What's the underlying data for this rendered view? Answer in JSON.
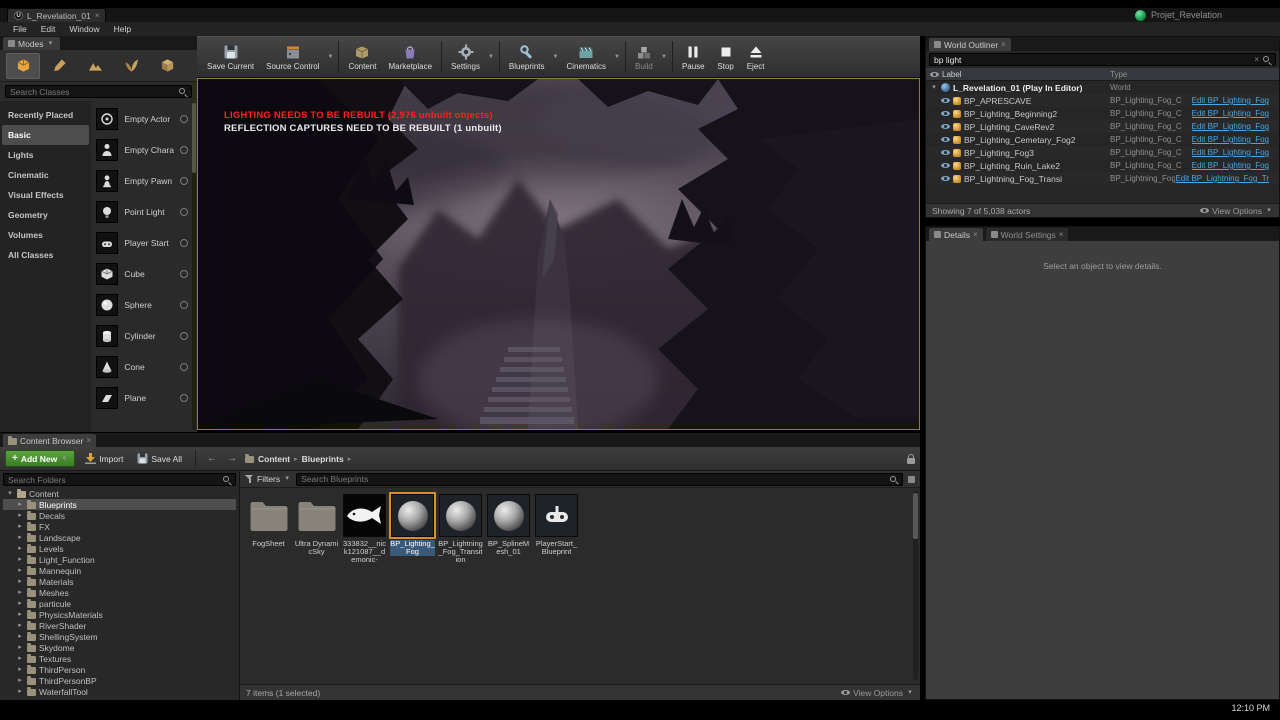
{
  "titlebar": {
    "tab_title": "L_Revelation_01",
    "project_name": "Projet_Revelation"
  },
  "menu": [
    "File",
    "Edit",
    "Window",
    "Help"
  ],
  "modes": {
    "tab": "Modes",
    "search_placeholder": "Search Classes",
    "categories": [
      "Recently Placed",
      "Basic",
      "Lights",
      "Cinematic",
      "Visual Effects",
      "Geometry",
      "Volumes",
      "All Classes"
    ],
    "selected_category": "Basic",
    "items": [
      "Empty Actor",
      "Empty Chara",
      "Empty Pawn",
      "Point Light",
      "Player Start",
      "Cube",
      "Sphere",
      "Cylinder",
      "Cone",
      "Plane"
    ]
  },
  "toolbar": [
    "Save Current",
    "Source Control",
    "Content",
    "Marketplace",
    "Settings",
    "Blueprints",
    "Cinematics",
    "Build",
    "Pause",
    "Stop",
    "Eject"
  ],
  "viewport": {
    "warning_lighting": "LIGHTING NEEDS TO BE REBUILT (2,976 unbuilt objects)",
    "warning_reflection": "REFLECTION CAPTURES NEED TO BE REBUILT (1 unbuilt)"
  },
  "outliner": {
    "tab": "World Outliner",
    "search_value": "bp light",
    "col_label": "Label",
    "col_type": "Type",
    "root": {
      "label": "L_Revelation_01 (Play In Editor)",
      "type": "World"
    },
    "rows": [
      {
        "label": "BP_APRESCAVE",
        "type": "BP_Lighting_Fog_C",
        "link": "Edit BP_Lighting_Fog"
      },
      {
        "label": "BP_Lighting_Beginning2",
        "type": "BP_Lighting_Fog_C",
        "link": "Edit BP_Lighting_Fog"
      },
      {
        "label": "BP_Lighting_CaveRev2",
        "type": "BP_Lighting_Fog_C",
        "link": "Edit BP_Lighting_Fog"
      },
      {
        "label": "BP_Lighting_Cemetary_Fog2",
        "type": "BP_Lighting_Fog_C",
        "link": "Edit BP_Lighting_Fog"
      },
      {
        "label": "BP_Lighting_Fog3",
        "type": "BP_Lighting_Fog_C",
        "link": "Edit BP_Lighting_Fog"
      },
      {
        "label": "BP_Lighting_Ruin_Lake2",
        "type": "BP_Lighting_Fog_C",
        "link": "Edit BP_Lighting_Fog"
      },
      {
        "label": "BP_Lightning_Fog_Transi",
        "type": "BP_Lightning_Fog_Transition_C",
        "link": "Edit BP_Lightning_Fog_Tr"
      }
    ],
    "status": "Showing 7 of 5,038 actors",
    "view_options": "View Options"
  },
  "details": {
    "tab_details": "Details",
    "tab_world_settings": "World Settings",
    "empty_message": "Select an object to view details."
  },
  "content_browser": {
    "tab": "Content Browser",
    "add_new": "Add New",
    "import": "Import",
    "save_all": "Save All",
    "breadcrumb": [
      "Content",
      "Blueprints"
    ],
    "filters": "Filters",
    "search_placeholder": "Search Blueprints",
    "folder_search_placeholder": "Search Folders",
    "tree_root": "Content",
    "tree": [
      "Blueprints",
      "Decals",
      "FX",
      "Landscape",
      "Levels",
      "Light_Function",
      "Mannequin",
      "Materials",
      "Meshes",
      "particule",
      "PhysicsMaterials",
      "RiverShader",
      "ShellingSystem",
      "Skydome",
      "Textures",
      "ThirdPerson",
      "ThirdPersonBP",
      "WaterfallTool"
    ],
    "assets": [
      {
        "name": "FogSheet",
        "kind": "folder"
      },
      {
        "name": "Ultra DynamicSky",
        "kind": "folder"
      },
      {
        "name": "333832__nick121087__demonic-",
        "kind": "texture"
      },
      {
        "name": "BP_Lighting_Fog",
        "kind": "blueprint",
        "selected": true
      },
      {
        "name": "BP_Lightning_Fog_Transition",
        "kind": "blueprint"
      },
      {
        "name": "BP_SplineMesh_01",
        "kind": "blueprint"
      },
      {
        "name": "PlayerStart_Blueprint",
        "kind": "blueprint"
      }
    ],
    "status": "7 items (1 selected)",
    "view_options": "View Options"
  },
  "taskbar": {
    "clock": "12:10 PM"
  },
  "colors": {
    "warning_red": "#ff2020",
    "link_blue": "#4da6e0",
    "add_new_green": "#4c8b2e",
    "asset_selection_orange": "#d98e2c",
    "viewport_border": "#8f7c42"
  }
}
